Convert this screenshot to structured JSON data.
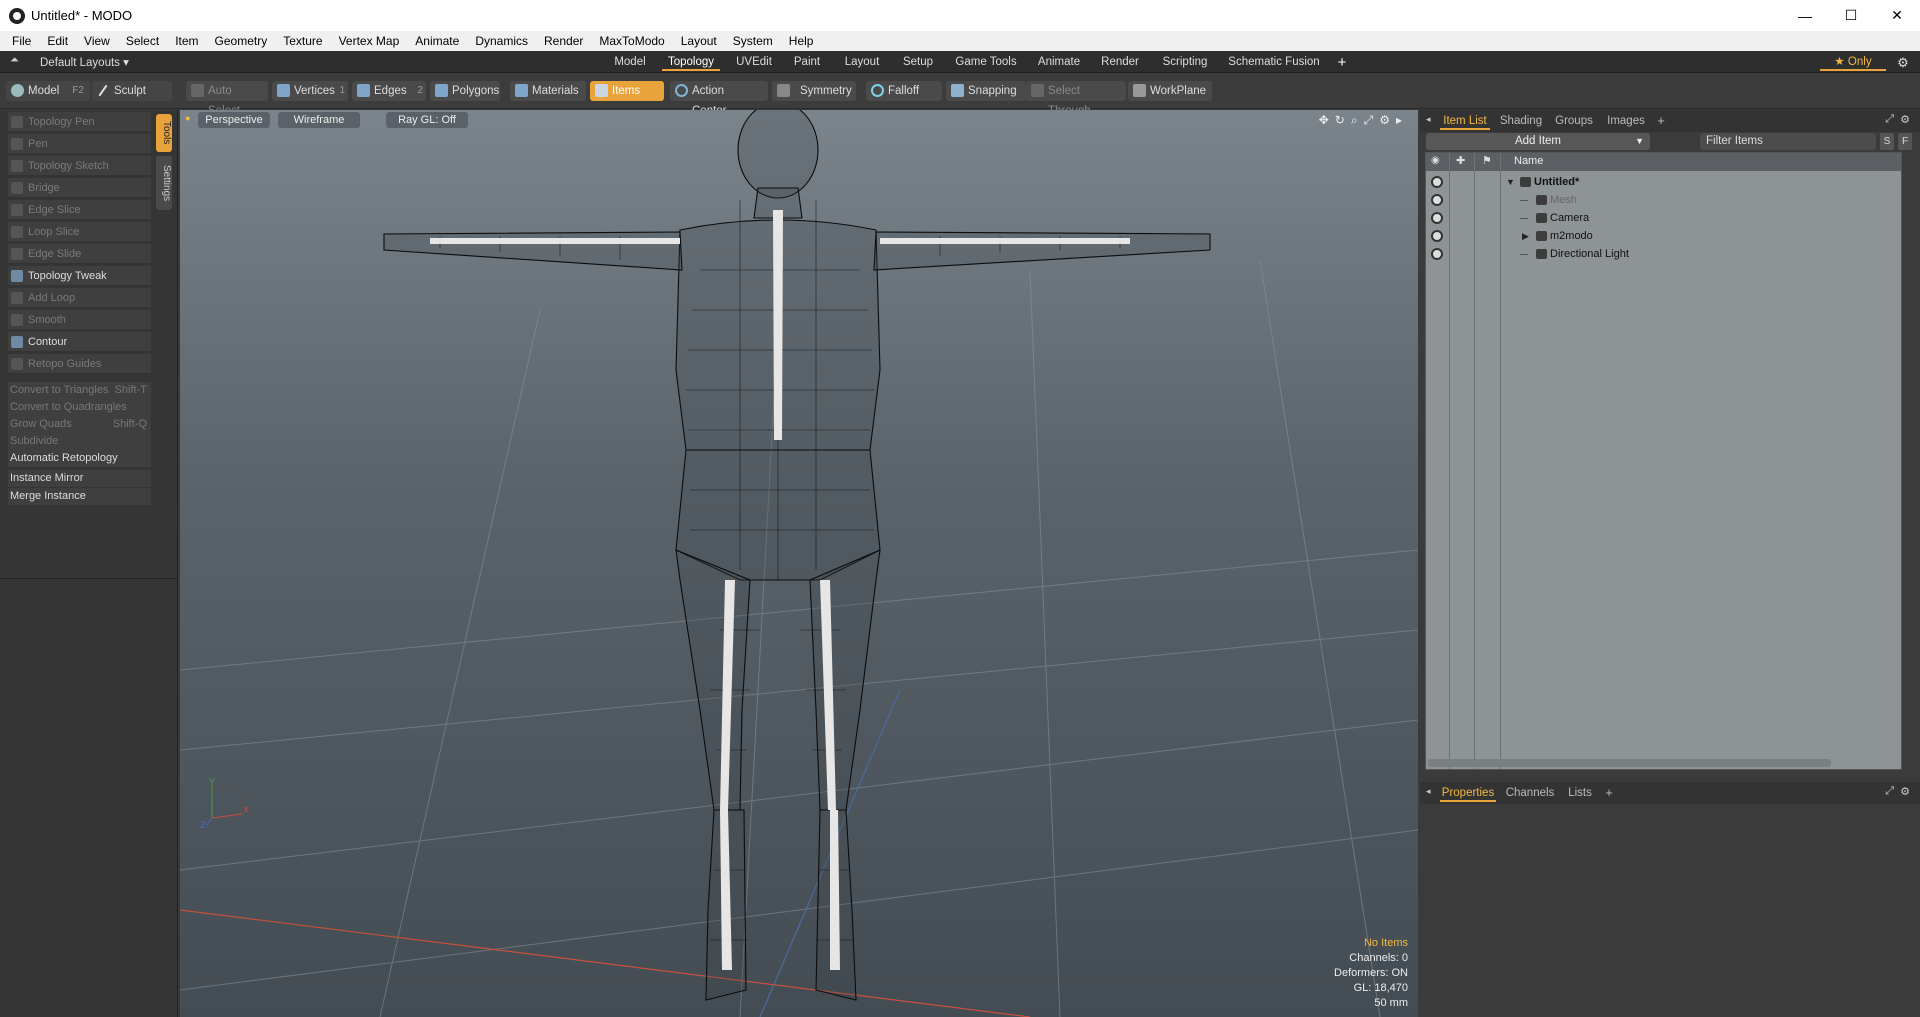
{
  "window": {
    "title": "Untitled* - MODO",
    "min": "—",
    "max": "☐",
    "close": "✕"
  },
  "menu": [
    "File",
    "Edit",
    "View",
    "Select",
    "Item",
    "Geometry",
    "Texture",
    "Vertex Map",
    "Animate",
    "Dynamics",
    "Render",
    "MaxToModo",
    "Layout",
    "System",
    "Help"
  ],
  "layoutbar": {
    "preset": "Default Layouts ▾",
    "tabs": [
      "Model",
      "Topology",
      "UVEdit",
      "Paint",
      "Layout",
      "Setup",
      "Game Tools",
      "Animate",
      "Render",
      "Scripting",
      "Schematic Fusion"
    ],
    "active_tab": "Topology",
    "add": "+",
    "only": "★ Only",
    "gear": "⚙"
  },
  "toolbar": {
    "model": "Model",
    "model_key": "F2",
    "sculpt": "Sculpt",
    "auto_select": "Auto Select",
    "vertices": "Vertices",
    "vertices_num": "1",
    "edges": "Edges",
    "edges_num": "2",
    "polygons": "Polygons",
    "materials": "Materials",
    "items": "Items",
    "action_center": "Action Center",
    "symmetry": "Symmetry",
    "falloff": "Falloff",
    "snapping": "Snapping",
    "select_through": "Select Through",
    "workplane": "WorkPlane"
  },
  "leftpanel": {
    "tab_tools": "Tools",
    "tab_settings": "Settings",
    "tools": [
      {
        "label": "Topology Pen",
        "dim": true
      },
      {
        "label": "Pen",
        "dim": true
      },
      {
        "label": "Topology Sketch",
        "dim": true
      },
      {
        "label": "Bridge",
        "dim": true
      },
      {
        "label": "Edge Slice",
        "dim": true
      },
      {
        "label": "Loop Slice",
        "dim": true
      },
      {
        "label": "Edge Slide",
        "dim": true
      },
      {
        "label": "Topology Tweak",
        "dim": false
      },
      {
        "label": "Add Loop",
        "dim": true
      },
      {
        "label": "Smooth",
        "dim": true
      },
      {
        "label": "Contour",
        "dim": false
      },
      {
        "label": "Retopo Guides",
        "dim": true
      }
    ],
    "commands": [
      {
        "label": "Convert to Triangles",
        "shortcut": "Shift-T",
        "dim": true
      },
      {
        "label": "Convert to Quadrangles",
        "shortcut": "",
        "dim": true
      },
      {
        "label": "Grow Quads",
        "shortcut": "Shift-Q",
        "dim": true
      },
      {
        "label": "Subdivide",
        "shortcut": "",
        "dim": true
      },
      {
        "label": "Automatic Retopology",
        "shortcut": "",
        "dim": false
      }
    ],
    "instance_mirror": "Instance Mirror",
    "merge_instance": "Merge Instance"
  },
  "viewport": {
    "projection": "Perspective",
    "shading": "Wireframe",
    "raygl": "Ray GL: Off",
    "hud": {
      "selection": "No Items",
      "channels": "Channels: 0",
      "deformers": "Deformers: ON",
      "gl": "GL: 18,470",
      "grid": "50 mm"
    },
    "axis_x": "X",
    "axis_y": "Y",
    "axis_z": "Z"
  },
  "rightpanel": {
    "tabs": [
      "Item List",
      "Shading",
      "Groups",
      "Images"
    ],
    "active_tab": "Item List",
    "add_item": "Add Item",
    "filter_placeholder": "Filter Items",
    "s_btn": "S",
    "f_btn": "F",
    "col_name": "Name",
    "items": [
      {
        "label": "Untitled*",
        "indent": 0,
        "bold": true,
        "arrow": "▼"
      },
      {
        "label": "Mesh",
        "indent": 1,
        "dim": true,
        "arrow": ""
      },
      {
        "label": "Camera",
        "indent": 1,
        "arrow": ""
      },
      {
        "label": "m2modo",
        "indent": 1,
        "arrow": "▶"
      },
      {
        "label": "Directional Light",
        "indent": 1,
        "arrow": ""
      }
    ],
    "bottom_tabs": [
      "Properties",
      "Channels",
      "Lists"
    ],
    "bottom_active": "Properties",
    "plus": "+"
  }
}
